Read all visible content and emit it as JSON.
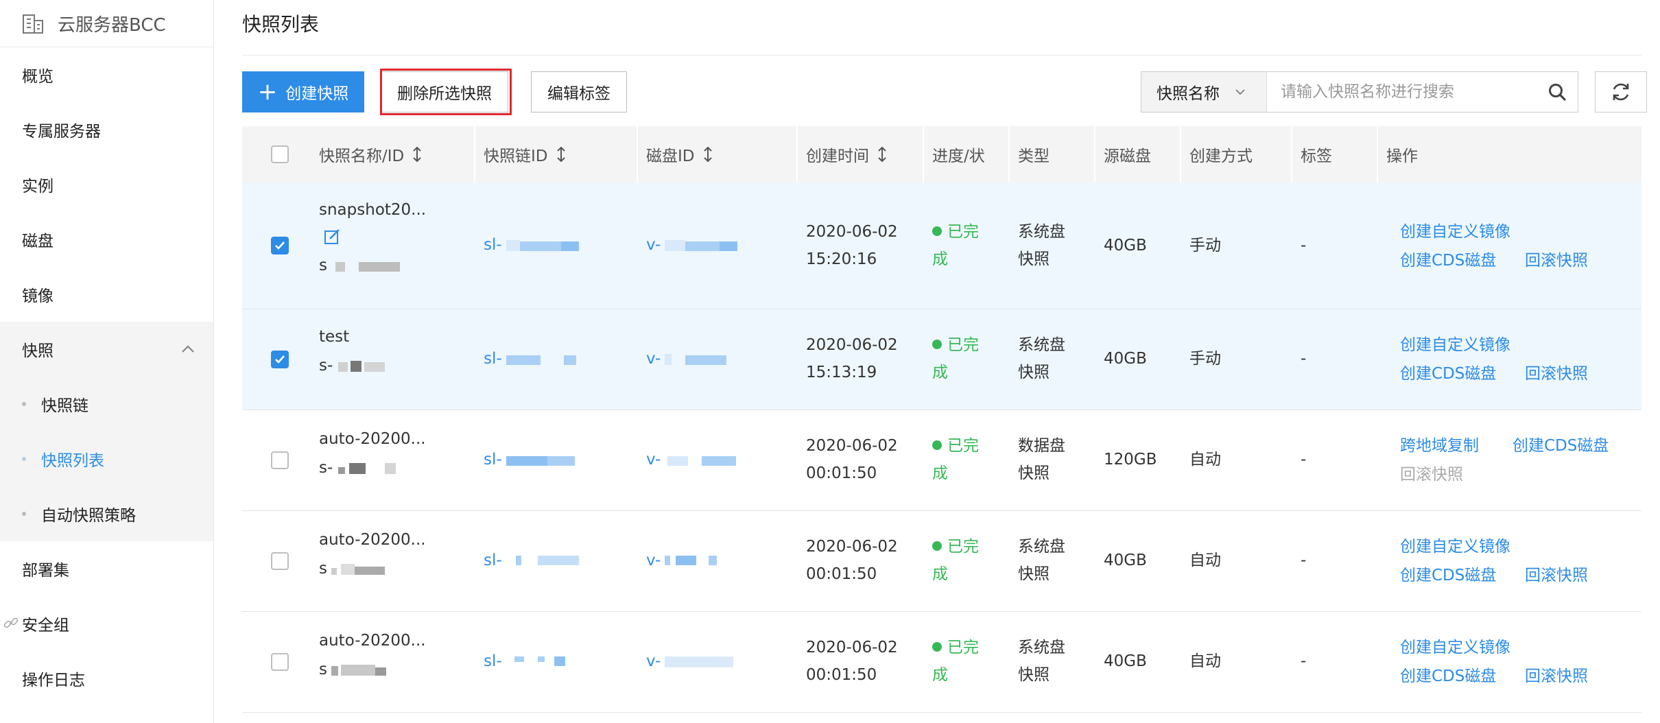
{
  "sidebar": {
    "title": "云服务器BCC",
    "items": [
      "概览",
      "专属服务器",
      "实例",
      "磁盘",
      "镜像"
    ],
    "group": {
      "label": "快照",
      "children": [
        "快照链",
        "快照列表",
        "自动快照策略"
      ]
    },
    "items_after": [
      "部署集",
      "安全组",
      "操作日志"
    ]
  },
  "page": {
    "title": "快照列表"
  },
  "toolbar": {
    "create_label": "创建快照",
    "delete_label": "删除所选快照",
    "edit_tag_label": "编辑标签",
    "search_select": "快照名称",
    "search_placeholder": "请输入快照名称进行搜索"
  },
  "table": {
    "headers": [
      "快照名称/ID",
      "快照链ID",
      "磁盘ID",
      "创建时间",
      "进度/状",
      "类型",
      "源磁盘",
      "创建方式",
      "标签",
      "操作"
    ],
    "rows": [
      {
        "name": "snapshot20...",
        "id_prefix": "s",
        "chain_prefix": "sl-",
        "disk_prefix": "v-",
        "date": "2020-06-02",
        "time": "15:20:16",
        "status_a": "已完",
        "status_b": "成",
        "type_a": "系统盘",
        "type_b": "快照",
        "size": "40GB",
        "method": "手动",
        "tag": "-",
        "ops": [
          "创建自定义镜像",
          "创建CDS磁盘",
          "回滚快照"
        ],
        "selected": true
      },
      {
        "name": "test",
        "id_prefix": "s-",
        "chain_prefix": "sl-",
        "disk_prefix": "v-",
        "date": "2020-06-02",
        "time": "15:13:19",
        "status_a": "已完",
        "status_b": "成",
        "type_a": "系统盘",
        "type_b": "快照",
        "size": "40GB",
        "method": "手动",
        "tag": "-",
        "ops": [
          "创建自定义镜像",
          "创建CDS磁盘",
          "回滚快照"
        ],
        "selected": true
      },
      {
        "name": "auto-20200...",
        "id_prefix": "s-",
        "chain_prefix": "sl-",
        "disk_prefix": "v-",
        "date": "2020-06-02",
        "time": "00:01:50",
        "status_a": "已完",
        "status_b": "成",
        "type_a": "数据盘",
        "type_b": "快照",
        "size": "120GB",
        "method": "自动",
        "tag": "-",
        "ops": [
          "跨地域复制",
          "创建CDS磁盘",
          "回滚快照"
        ],
        "selected": false
      },
      {
        "name": "auto-20200...",
        "id_prefix": "s",
        "chain_prefix": "sl-",
        "disk_prefix": "v-",
        "date": "2020-06-02",
        "time": "00:01:50",
        "status_a": "已完",
        "status_b": "成",
        "type_a": "系统盘",
        "type_b": "快照",
        "size": "40GB",
        "method": "自动",
        "tag": "-",
        "ops": [
          "创建自定义镜像",
          "创建CDS磁盘",
          "回滚快照"
        ],
        "selected": false
      },
      {
        "name": "auto-20200...",
        "id_prefix": "s",
        "chain_prefix": "sl-",
        "disk_prefix": "v-",
        "date": "2020-06-02",
        "time": "00:01:50",
        "status_a": "已完",
        "status_b": "成",
        "type_a": "系统盘",
        "type_b": "快照",
        "size": "40GB",
        "method": "自动",
        "tag": "-",
        "ops": [
          "创建自定义镜像",
          "创建CDS磁盘",
          "回滚快照"
        ],
        "selected": false
      }
    ]
  },
  "colors": {
    "accent": "#2d8ce6",
    "success": "#37b856",
    "highlight": "#e0272d",
    "selected_row": "#eef7fd"
  },
  "icons": [
    "building-icon",
    "chevron-up-icon",
    "link-icon",
    "plus-icon",
    "chevron-down-icon",
    "search-icon",
    "refresh-icon",
    "sort-icon",
    "edit-icon",
    "check-icon"
  ]
}
